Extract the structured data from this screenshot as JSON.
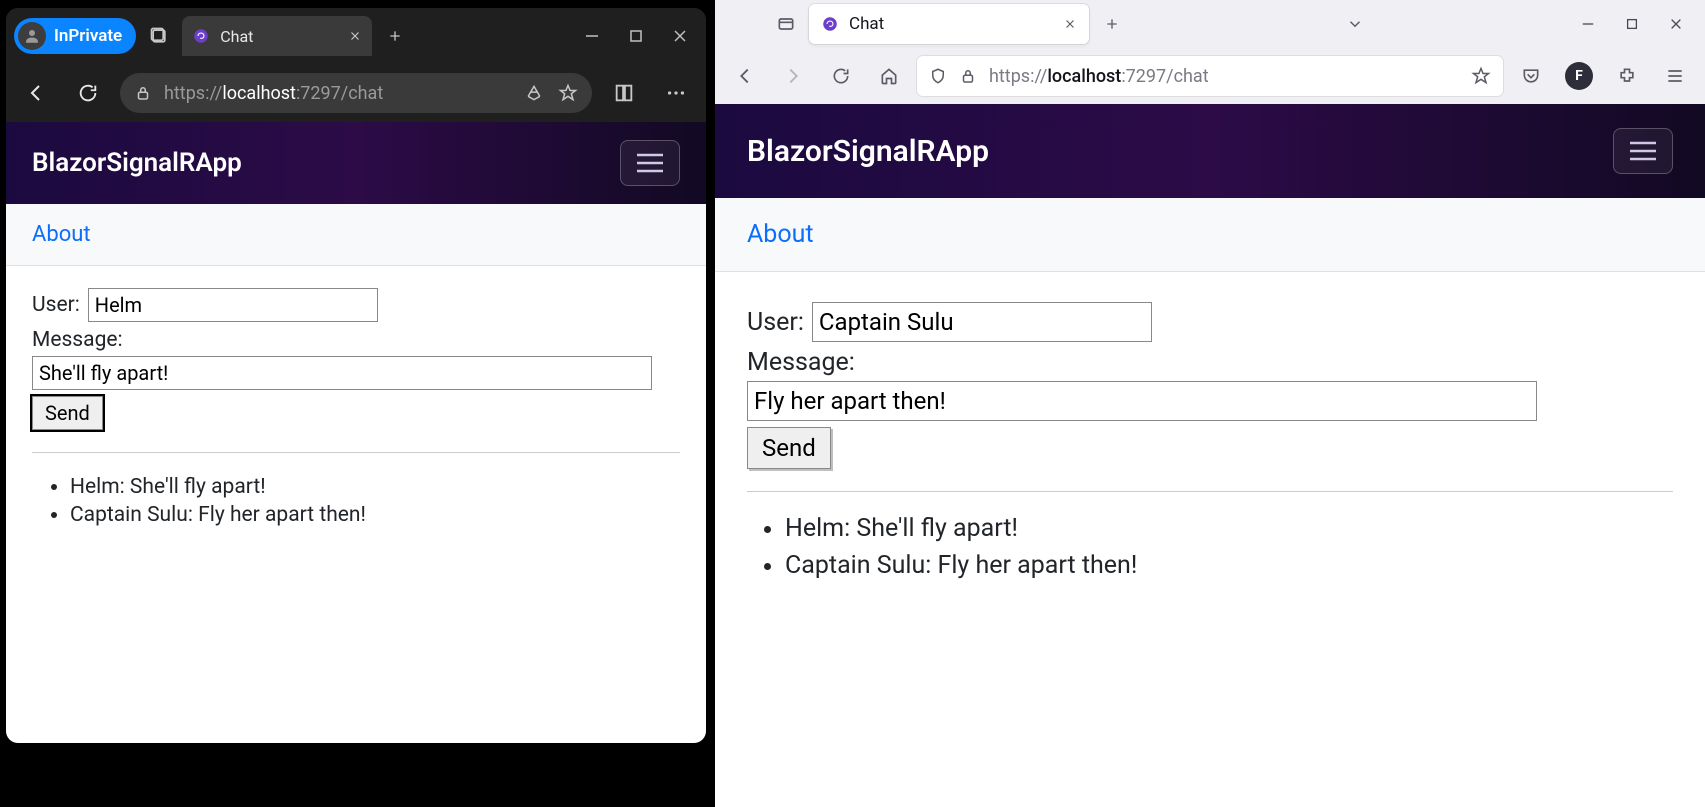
{
  "edge": {
    "profile_label": "InPrivate",
    "tab_title": "Chat",
    "url_scheme": "https://",
    "url_host": "localhost",
    "url_port_path": ":7297/chat"
  },
  "ff": {
    "tab_title": "Chat",
    "url_scheme": "https://",
    "url_host": "localhost",
    "url_port_path": ":7297/chat",
    "profile_letter": "F"
  },
  "app": {
    "brand": "BlazorSignalRApp",
    "about_label": "About",
    "user_label": "User:",
    "message_label": "Message:",
    "send_label": "Send"
  },
  "left_instance": {
    "user_value": "Helm",
    "message_value": "She'll fly apart!",
    "messages": [
      "Helm: She'll fly apart!",
      "Captain Sulu: Fly her apart then!"
    ]
  },
  "right_instance": {
    "user_value": "Captain Sulu",
    "message_value": "Fly her apart then!",
    "messages": [
      "Helm: She'll fly apart!",
      "Captain Sulu: Fly her apart then!"
    ]
  }
}
